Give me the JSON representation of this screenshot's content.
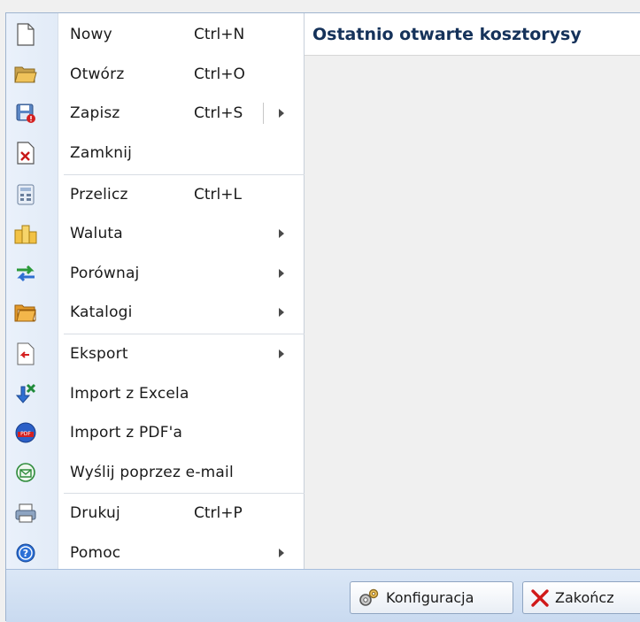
{
  "menu": {
    "items": [
      {
        "label": "Nowy",
        "shortcut": "Ctrl+N",
        "icon": "new-document-icon",
        "submenu": false
      },
      {
        "label": "Otwórz",
        "shortcut": "Ctrl+O",
        "icon": "open-folder-icon",
        "submenu": false
      },
      {
        "label": "Zapisz",
        "shortcut": "Ctrl+S",
        "icon": "save-icon",
        "submenu": true
      },
      {
        "label": "Zamknij",
        "shortcut": "",
        "icon": "close-document-icon",
        "submenu": false
      },
      {
        "label": "Przelicz",
        "shortcut": "Ctrl+L",
        "icon": "calculator-icon",
        "submenu": false
      },
      {
        "label": "Waluta",
        "shortcut": "",
        "icon": "coins-icon",
        "submenu": true
      },
      {
        "label": "Porównaj",
        "shortcut": "",
        "icon": "compare-arrows-icon",
        "submenu": true
      },
      {
        "label": "Katalogi",
        "shortcut": "",
        "icon": "catalogs-icon",
        "submenu": true
      },
      {
        "label": "Eksport",
        "shortcut": "",
        "icon": "export-icon",
        "submenu": true
      },
      {
        "label": "Import z Excela",
        "shortcut": "",
        "icon": "import-excel-icon",
        "submenu": false
      },
      {
        "label": "Import z PDF'a",
        "shortcut": "",
        "icon": "import-pdf-icon",
        "submenu": false
      },
      {
        "label": "Wyślij poprzez e-mail",
        "shortcut": "",
        "icon": "email-icon",
        "submenu": false
      },
      {
        "label": "Drukuj",
        "shortcut": "Ctrl+P",
        "icon": "printer-icon",
        "submenu": false
      },
      {
        "label": "Pomoc",
        "shortcut": "",
        "icon": "help-icon",
        "submenu": true
      }
    ]
  },
  "recent": {
    "title": "Ostatnio otwarte kosztorysy"
  },
  "footer": {
    "config_label": "Konfiguracja",
    "config_icon": "gears-icon",
    "exit_label": "Zakończ",
    "exit_icon": "red-x-icon"
  },
  "colors": {
    "accent": "#15325a",
    "bar": "#c9daf0",
    "border": "#8ea4c1"
  }
}
